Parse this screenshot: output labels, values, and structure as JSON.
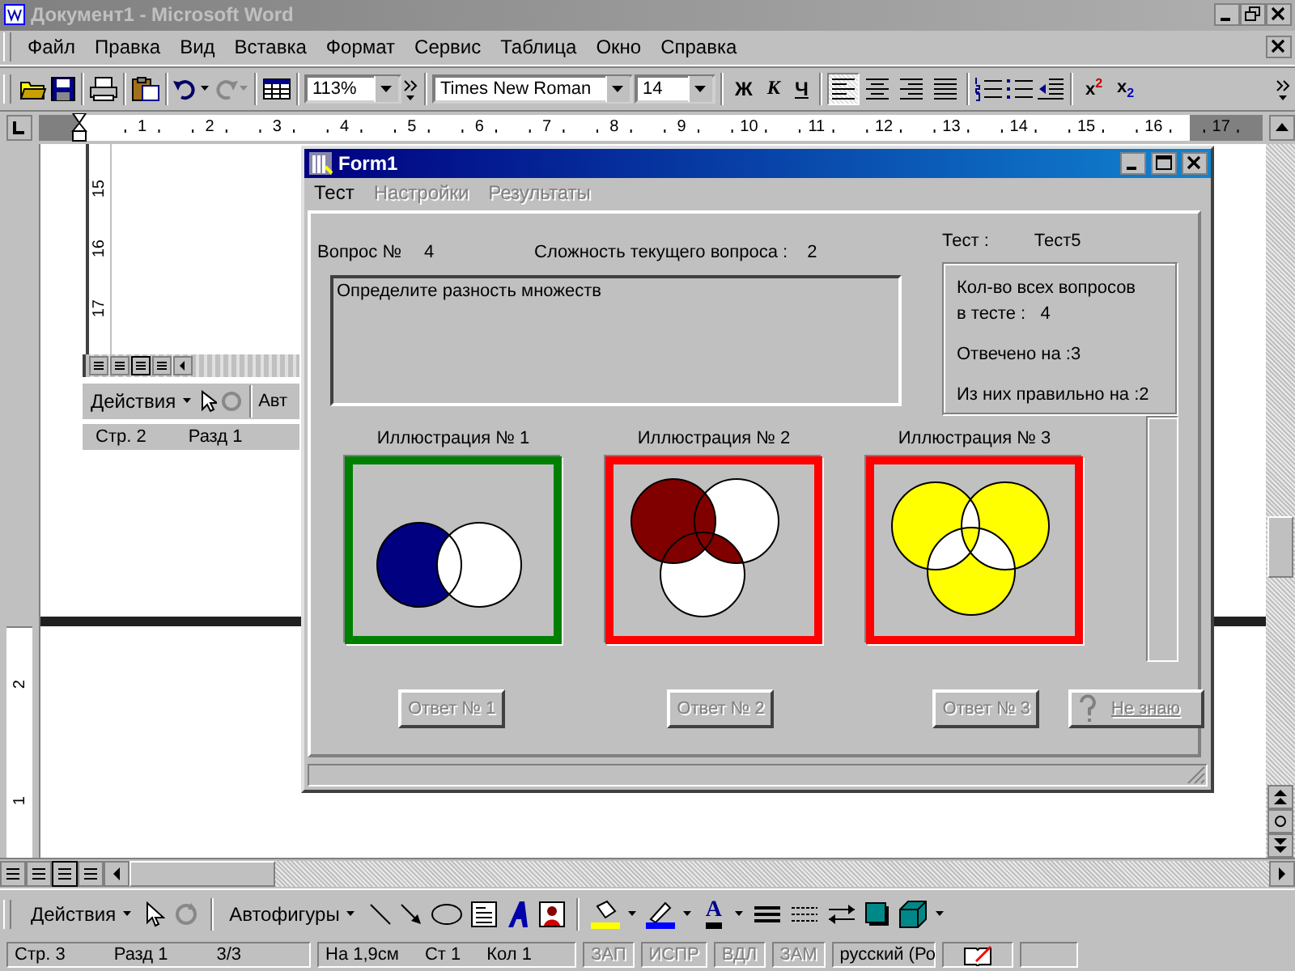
{
  "window": {
    "title": "Документ1 - Microsoft Word"
  },
  "menu": [
    {
      "label": "Файл"
    },
    {
      "label": "Правка"
    },
    {
      "label": "Вид"
    },
    {
      "label": "Вставка"
    },
    {
      "label": "Формат"
    },
    {
      "label": "Сервис"
    },
    {
      "label": "Таблица"
    },
    {
      "label": "Окно"
    },
    {
      "label": "Справка"
    }
  ],
  "toolbar": {
    "zoom": "113%",
    "font": "Times New Roman",
    "font_size": "14",
    "format_buttons": [
      {
        "label": "Ж",
        "kind": "bold"
      },
      {
        "label": "К",
        "kind": "italic"
      },
      {
        "label": "Ч",
        "kind": "underline"
      }
    ],
    "align_buttons": [
      {
        "selected": true
      },
      {
        "selected": false
      },
      {
        "selected": false
      },
      {
        "selected": false
      }
    ],
    "script_buttons": [
      {
        "label": "x$^{2}$"
      },
      {
        "label": "x$_{2}$"
      }
    ]
  },
  "ruler": {
    "marks": [
      "1",
      "2",
      "3",
      "4",
      "5",
      "6",
      "7",
      "8",
      "9",
      "10",
      "11",
      "12",
      "13",
      "14",
      "15",
      "16",
      "17"
    ]
  },
  "vertical_ruler": {
    "marks": [
      "2",
      "1"
    ]
  },
  "embedded_document": {
    "ruler_marks": [
      "15",
      "16",
      "17"
    ],
    "toolbar_label": "Действия",
    "cut_label": "Авт",
    "status": [
      "Стр. 2",
      "Разд 1"
    ]
  },
  "form": {
    "title": "Form1",
    "menu": [
      {
        "label": "Тест",
        "disabled": false
      },
      {
        "label": "Настройки",
        "disabled": true
      },
      {
        "label": "Результаты",
        "disabled": true
      }
    ],
    "question_label": "Вопрос №",
    "question_number": "4",
    "difficulty_label": "Сложность текущего вопроса :",
    "difficulty": "2",
    "question_text": "Определите разность множеств",
    "test_label": "Тест :",
    "test_name": "Тест5",
    "stats": [
      {
        "lines": [
          "Кол-во всех вопросов",
          "в тесте :   4"
        ]
      },
      {
        "lines": [
          "Отвечено на :3"
        ]
      },
      {
        "lines": [
          "Из них правильно на :2"
        ]
      }
    ],
    "illustrations": [
      {
        "caption": "Иллюстрация № 1",
        "color": "#008000",
        "kind": "difference"
      },
      {
        "caption": "Иллюстрация № 2",
        "color": "#ff0000",
        "kind": "mixed"
      },
      {
        "caption": "Иллюстрация № 3",
        "color": "#ff0000",
        "kind": "symmetric"
      }
    ],
    "answers": [
      {
        "label": "Ответ № 1",
        "disabled": true
      },
      {
        "label": "Ответ № 2",
        "disabled": true
      },
      {
        "label": "Ответ № 3",
        "disabled": true
      }
    ],
    "dont_know": {
      "label": "Не знаю",
      "disabled": true
    }
  },
  "drawing_toolbar": {
    "actions": "Действия",
    "autoshapes": "Автофигуры",
    "font_color_glyph": "A"
  },
  "status_bar": {
    "fields": [
      "Стр. 3",
      "Разд 1",
      "3/3",
      "На 1,9см",
      "Ст 1",
      "Кол 1"
    ],
    "modes": [
      {
        "label": "ЗАП",
        "on": false
      },
      {
        "label": "ИСПР",
        "on": false
      },
      {
        "label": "ВДЛ",
        "on": false
      },
      {
        "label": "ЗАМ",
        "on": false
      }
    ],
    "language": "русский (Ро"
  }
}
